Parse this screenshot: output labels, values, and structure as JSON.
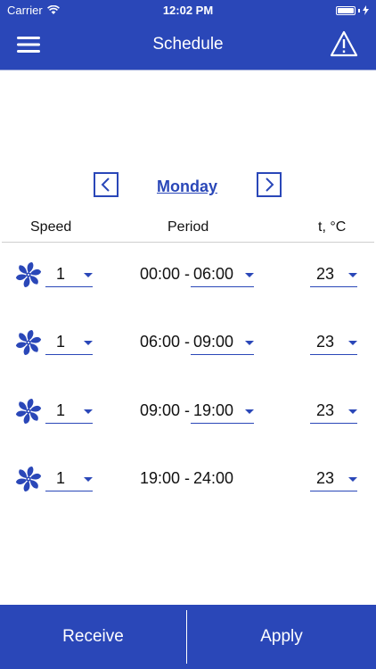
{
  "status_bar": {
    "carrier": "Carrier",
    "time": "12:02 PM"
  },
  "header": {
    "title": "Schedule",
    "menu_icon": "hamburger-menu-icon",
    "warning_icon": "warning-triangle-icon"
  },
  "day_nav": {
    "day": "Monday",
    "prev_icon": "chevron-left-icon",
    "next_icon": "chevron-right-icon"
  },
  "columns": {
    "speed": "Speed",
    "period": "Period",
    "temp": "t, °C"
  },
  "rows": [
    {
      "speed": "1",
      "start": "00:00",
      "dash": "-",
      "end": "06:00",
      "temp": "23",
      "end_editable": true
    },
    {
      "speed": "1",
      "start": "06:00",
      "dash": "-",
      "end": "09:00",
      "temp": "23",
      "end_editable": true
    },
    {
      "speed": "1",
      "start": "09:00",
      "dash": "-",
      "end": "19:00",
      "temp": "23",
      "end_editable": true
    },
    {
      "speed": "1",
      "start": "19:00",
      "dash": "-",
      "end": "24:00",
      "temp": "23",
      "end_editable": false
    }
  ],
  "footer": {
    "receive_label": "Receive",
    "apply_label": "Apply"
  },
  "colors": {
    "accent": "#2a47b8"
  }
}
